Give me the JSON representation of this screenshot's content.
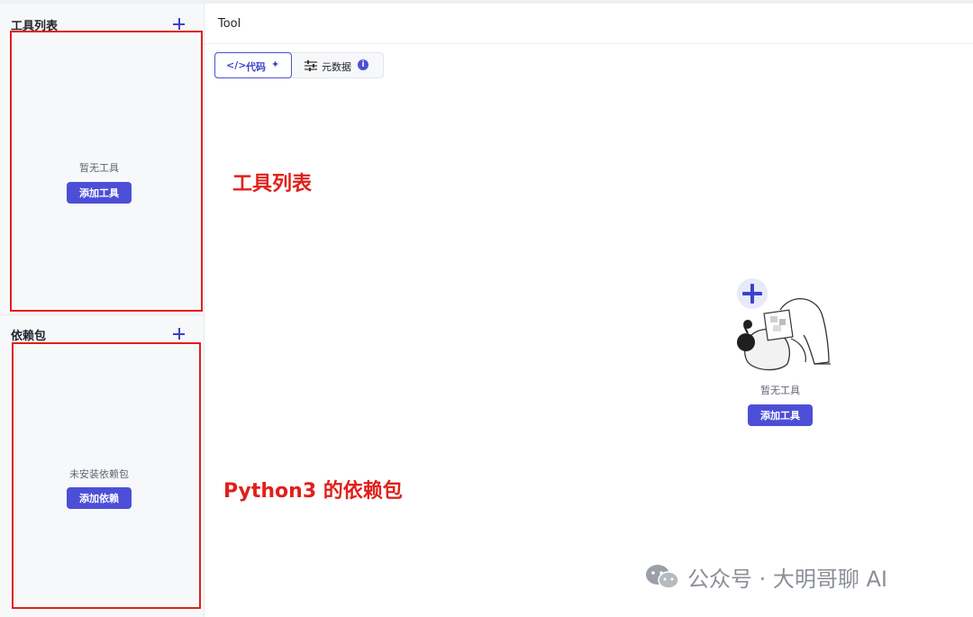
{
  "sidebar": {
    "tools_title": "工具列表",
    "tools_empty": "暂无工具",
    "tools_add": "添加工具",
    "deps_title": "依赖包",
    "deps_empty": "未安装依赖包",
    "deps_add": "添加依赖"
  },
  "header": {
    "title": "Tool"
  },
  "tabs": [
    {
      "label": "代码",
      "icon": "code-icon",
      "selected": true
    },
    {
      "label": "元数据",
      "icon": "sliders-icon",
      "badge": "i"
    }
  ],
  "main": {
    "empty_text": "暂无工具",
    "add_button": "添加工具"
  },
  "annotations": {
    "tools": "工具列表",
    "deps": "Python3 的依赖包"
  },
  "watermark": {
    "text": "公众号 · 大明哥聊 AI"
  },
  "colors": {
    "primary": "#4c4fd6",
    "annotation_red": "#e0201b",
    "sidebar_bg": "#f7f8fa"
  }
}
